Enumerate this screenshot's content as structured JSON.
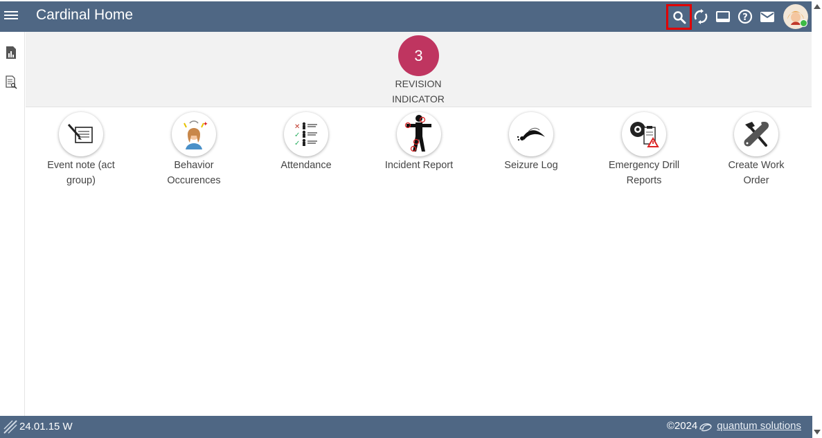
{
  "header": {
    "title": "Cardinal Home",
    "icons": [
      "menu-icon",
      "search-icon",
      "sync-icon",
      "screen-icon",
      "help-icon",
      "mail-icon",
      "avatar"
    ]
  },
  "sidebar": {
    "icons": [
      "report-icon",
      "document-search-icon"
    ]
  },
  "revision": {
    "count": "3",
    "label_line1": "REVISION",
    "label_line2": "INDICATOR",
    "badge_color": "#bf3560"
  },
  "tiles": [
    {
      "line1": "Event note (act",
      "line2": "group)",
      "icon": "note-pen-icon"
    },
    {
      "line1": "Behavior",
      "line2": "Occurences",
      "icon": "behavior-person-icon"
    },
    {
      "line1": "Attendance",
      "line2": "",
      "icon": "attendance-checklist-icon"
    },
    {
      "line1": "Incident Report",
      "line2": "",
      "icon": "incident-body-icon"
    },
    {
      "line1": "Seizure Log",
      "line2": "",
      "icon": "seizure-icon"
    },
    {
      "line1": "Emergency Drill",
      "line2": "Reports",
      "icon": "emergency-drill-icon"
    },
    {
      "line1": "Create Work",
      "line2": "Order",
      "icon": "tools-icon"
    }
  ],
  "footer": {
    "version": "24.01.15 W",
    "copyright": "©2024",
    "brand": "quantum solutions"
  },
  "colors": {
    "header": "#4f6784",
    "highlight": "#e00000"
  }
}
